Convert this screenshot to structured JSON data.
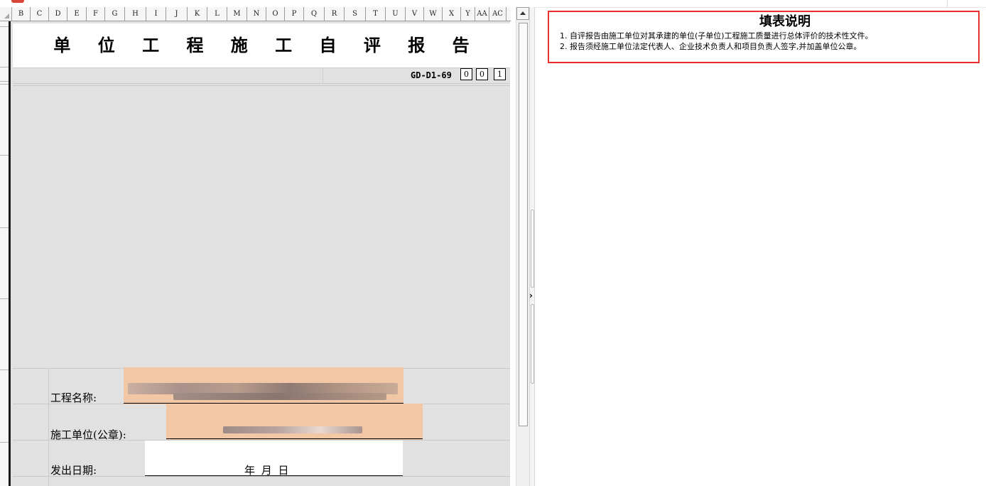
{
  "sheet": {
    "columns": [
      "B",
      "C",
      "D",
      "E",
      "F",
      "G",
      "H",
      "I",
      "J",
      "K",
      "L",
      "M",
      "N",
      "O",
      "P",
      "Q",
      "R",
      "S",
      "T",
      "U",
      "V",
      "W",
      "X",
      "Y",
      "AA",
      "AC"
    ],
    "title": "单 位 工 程 施 工 自 评 报 告",
    "form_code": "GD-D1-69",
    "code_boxes": [
      "0",
      "0",
      "1"
    ],
    "fields": {
      "project_name_label": "工程名称:",
      "contractor_label": "施工单位(公章):",
      "issue_date_label": "发出日期:",
      "date_value": "年  月  日"
    },
    "colors": {
      "input_fill": "#f2c7a6",
      "area_fill": "#e1e1e1"
    }
  },
  "instructions": {
    "title": "填表说明",
    "items": [
      "1. 自评报告由施工单位对其承建的单位(子单位)工程施工质量进行总体评价的技术性文件。",
      "2. 报告须经施工单位法定代表人、企业技术负责人和项目负责人签字,并加盖单位公章。"
    ],
    "border_color": "#e8312e"
  }
}
